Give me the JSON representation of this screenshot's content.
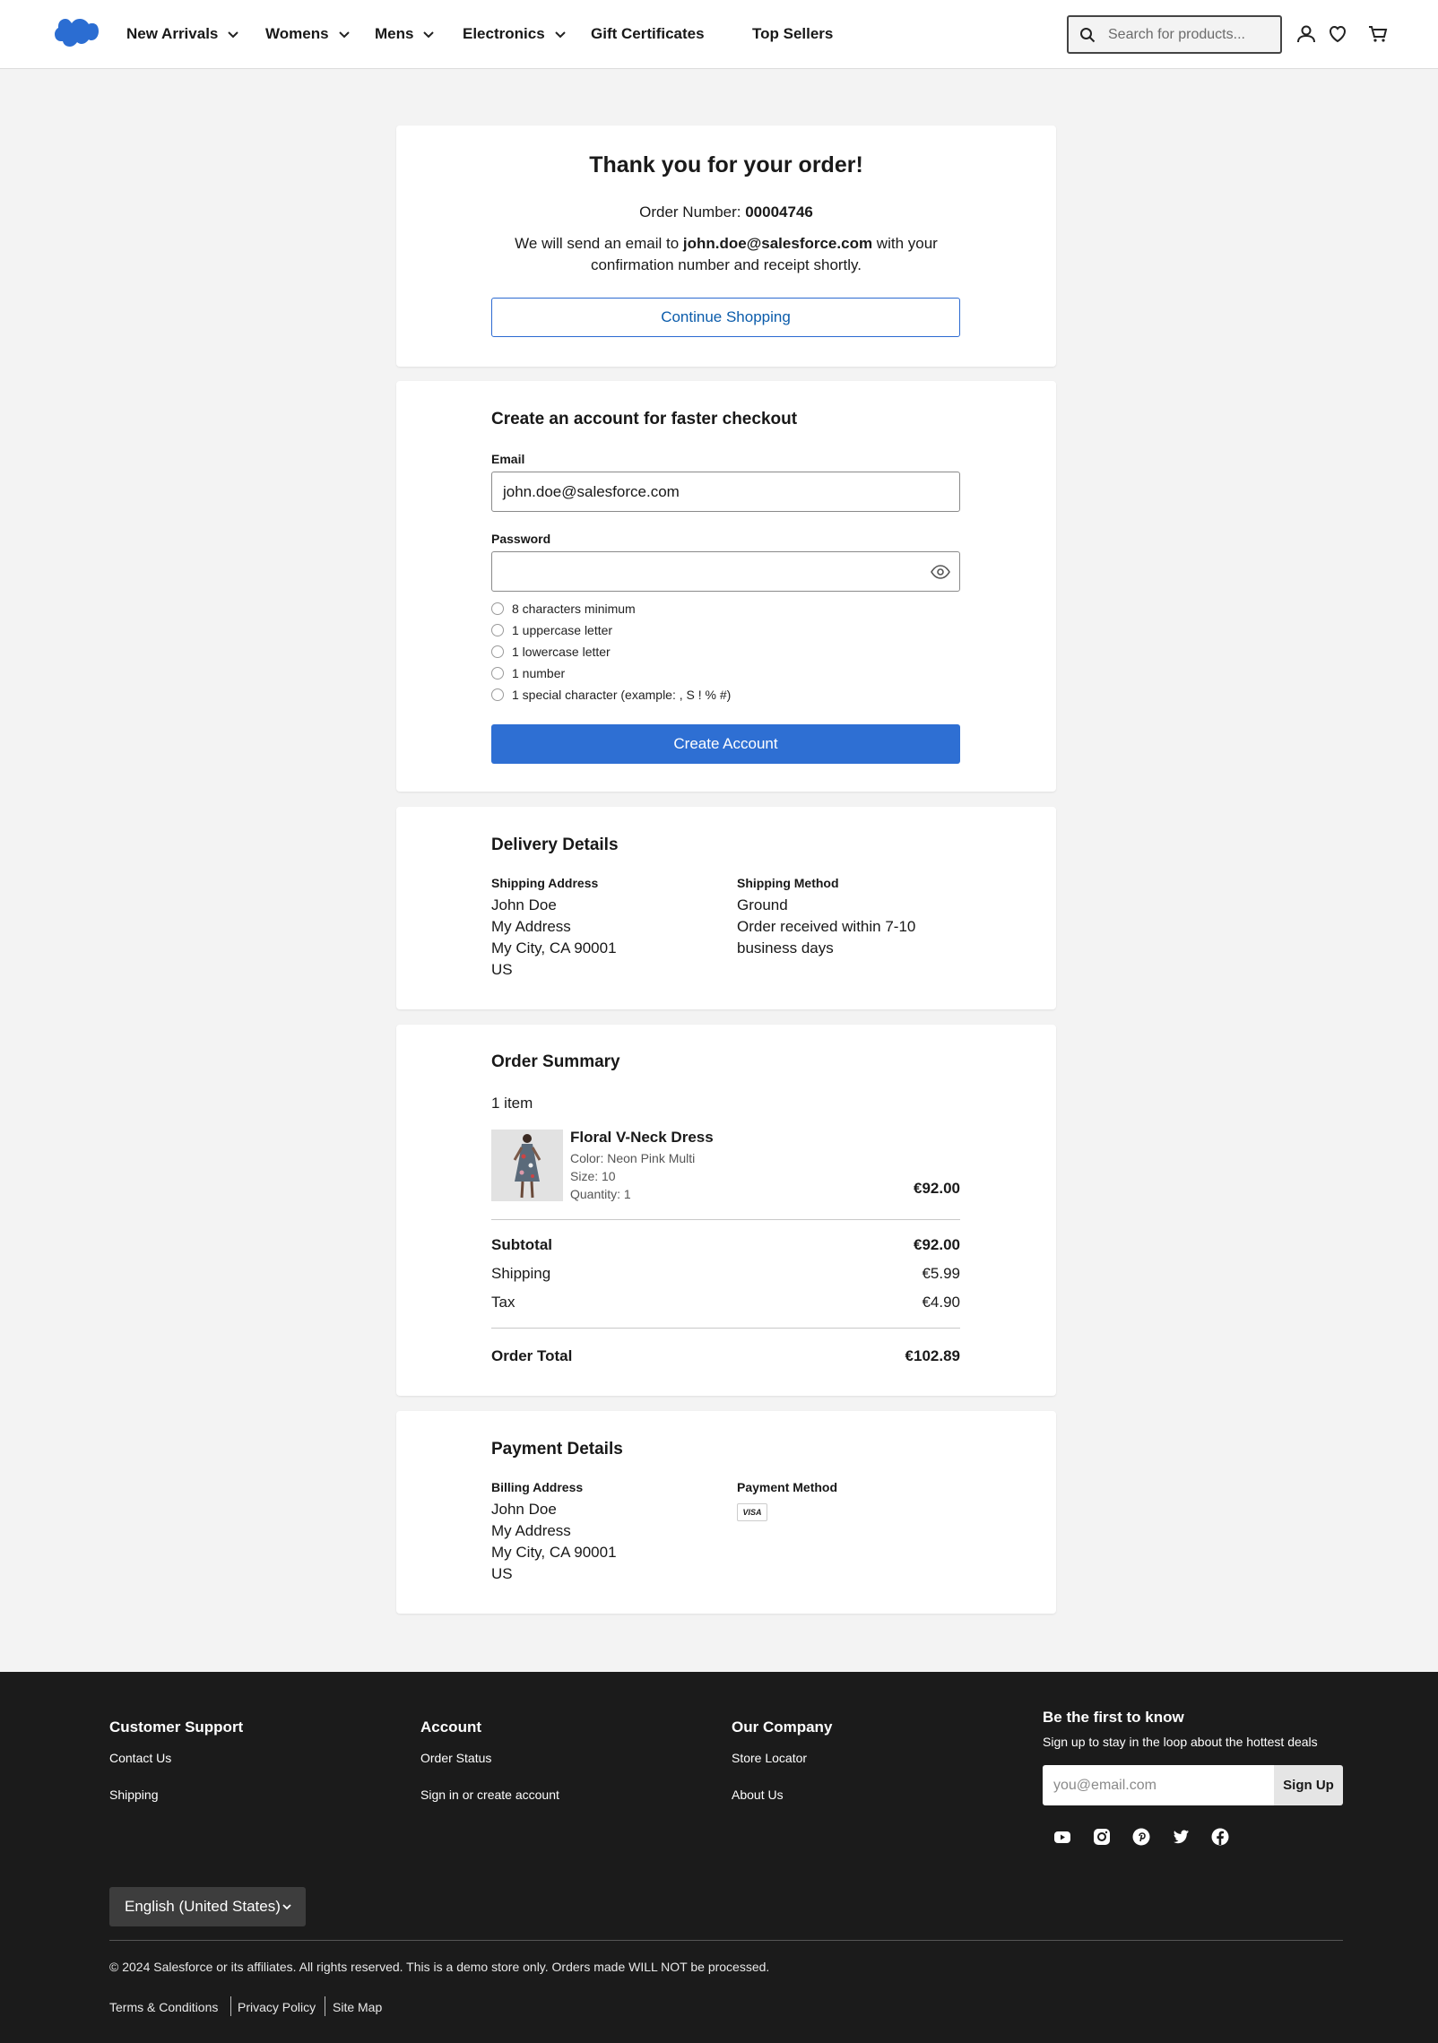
{
  "header": {
    "logo_alt": "Salesforce",
    "nav": [
      {
        "label": "New Arrivals",
        "has_dropdown": true
      },
      {
        "label": "Womens",
        "has_dropdown": true
      },
      {
        "label": "Mens",
        "has_dropdown": true
      },
      {
        "label": "Electronics",
        "has_dropdown": true
      },
      {
        "label": "Gift Certificates",
        "has_dropdown": false
      },
      {
        "label": "Top Sellers",
        "has_dropdown": false
      }
    ],
    "search_placeholder": "Search for products...",
    "icons": [
      "account-icon",
      "wishlist-icon",
      "cart-icon"
    ]
  },
  "confirmation": {
    "title": "Thank you for your order!",
    "order_number_label": "Order Number: ",
    "order_number": "00004746",
    "email_pre": "We will send an email to ",
    "email": "john.doe@salesforce.com",
    "email_post": " with your confirmation number and receipt shortly.",
    "continue_button": "Continue Shopping"
  },
  "create_account": {
    "title": "Create an account for faster checkout",
    "email_label": "Email",
    "email_value": "john.doe@salesforce.com",
    "password_label": "Password",
    "password_value": "",
    "requirements": [
      "8 characters minimum",
      "1 uppercase letter",
      "1 lowercase letter",
      "1 number",
      "1 special character (example: , S ! % #)"
    ],
    "submit_button": "Create Account"
  },
  "delivery": {
    "title": "Delivery Details",
    "address_label": "Shipping Address",
    "address": [
      "John Doe",
      "My Address",
      "My City, CA 90001",
      "US"
    ],
    "method_label": "Shipping Method",
    "method": [
      "Ground",
      "Order received within 7-10",
      "business days"
    ]
  },
  "summary": {
    "title": "Order Summary",
    "item_count": "1 item",
    "item": {
      "name": "Floral V-Neck Dress",
      "color": "Color: Neon Pink Multi",
      "size": "Size: 10",
      "quantity": "Quantity: 1",
      "price": "€92.00"
    },
    "subtotal_label": "Subtotal",
    "subtotal": "€92.00",
    "shipping_label": "Shipping",
    "shipping": "€5.99",
    "tax_label": "Tax",
    "tax": "€4.90",
    "total_label": "Order Total",
    "total": "€102.89"
  },
  "payment": {
    "title": "Payment Details",
    "billing_label": "Billing Address",
    "billing": [
      "John Doe",
      "My Address",
      "My City, CA 90001",
      "US"
    ],
    "method_label": "Payment Method",
    "card_brand": "VISA"
  },
  "footer": {
    "columns": [
      {
        "title": "Customer Support",
        "links": [
          "Contact Us",
          "Shipping"
        ]
      },
      {
        "title": "Account",
        "links": [
          "Order Status",
          "Sign in or create account"
        ]
      },
      {
        "title": "Our Company",
        "links": [
          "Store Locator",
          "About Us"
        ]
      }
    ],
    "newsletter_title": "Be the first to know",
    "newsletter_sub": "Sign up to stay in the loop about the hottest deals",
    "newsletter_placeholder": "you@email.com",
    "newsletter_button": "Sign Up",
    "social": [
      "youtube-icon",
      "instagram-icon",
      "pinterest-icon",
      "twitter-icon",
      "facebook-icon"
    ],
    "language": "English (United States)",
    "copyright": "© 2024 Salesforce or its affiliates. All rights reserved. This is a demo store only. Orders made WILL NOT be processed.",
    "legal": [
      "Terms & Conditions",
      "Privacy Policy",
      "Site Map"
    ]
  },
  "colors": {
    "accent": "#2e6fd3",
    "link": "#0b5cab",
    "footer_bg": "#1b1b1b",
    "page_bg": "#f3f3f3"
  }
}
